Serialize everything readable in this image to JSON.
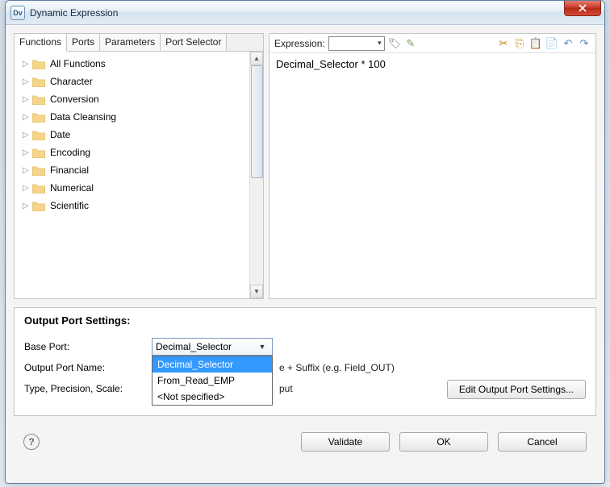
{
  "window": {
    "title": "Dynamic Expression",
    "app_icon_text": "Dv"
  },
  "tabs": [
    "Functions",
    "Ports",
    "Parameters",
    "Port Selector"
  ],
  "active_tab": 0,
  "tree": {
    "items": [
      "All Functions",
      "Character",
      "Conversion",
      "Data Cleansing",
      "Date",
      "Encoding",
      "Financial",
      "Numerical",
      "Scientific"
    ]
  },
  "expression": {
    "label": "Expression:",
    "body": "Decimal_Selector * 100"
  },
  "output_settings": {
    "title": "Output Port Settings:",
    "rows": {
      "base_port": {
        "label": "Base Port:",
        "value": "Decimal_Selector"
      },
      "output_port_name": {
        "label": "Output Port Name:",
        "hint_suffix": "e + Suffix (e.g. Field_OUT)"
      },
      "type_precision_scale": {
        "label": "Type, Precision, Scale:",
        "hint_suffix": "put"
      }
    },
    "dropdown_options": [
      "Decimal_Selector",
      "From_Read_EMP",
      "<Not specified>"
    ],
    "edit_button": "Edit Output Port Settings..."
  },
  "footer": {
    "validate": "Validate",
    "ok": "OK",
    "cancel": "Cancel"
  }
}
